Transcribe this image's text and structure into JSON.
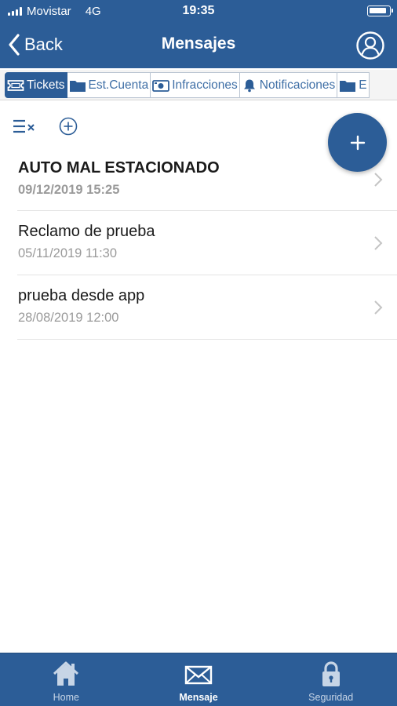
{
  "status_bar": {
    "carrier": "Movistar",
    "network": "4G",
    "time": "19:35"
  },
  "nav": {
    "back_label": "Back",
    "title": "Mensajes",
    "profile_icon": "user-circle-icon"
  },
  "tabs": [
    {
      "label": "Tickets",
      "icon": "ticket-icon",
      "active": true
    },
    {
      "label": "Est.Cuenta",
      "icon": "folder-icon",
      "active": false
    },
    {
      "label": "Infracciones",
      "icon": "camera-icon",
      "active": false
    },
    {
      "label": "Notificaciones",
      "icon": "bell-icon",
      "active": false
    },
    {
      "label": "E",
      "icon": "folder-icon",
      "active": false
    }
  ],
  "toolbar": {
    "clear_icon": "clear-list-icon",
    "add_icon": "add-circle-icon"
  },
  "fab": {
    "label": "+"
  },
  "messages": [
    {
      "subject": "AUTO MAL ESTACIONADO",
      "date": "09/12/2019 15:25",
      "unread": true
    },
    {
      "subject": "Reclamo de prueba",
      "date": "05/11/2019 11:30",
      "unread": false
    },
    {
      "subject": "prueba desde app",
      "date": "28/08/2019 12:00",
      "unread": false
    }
  ],
  "bottom_nav": [
    {
      "label": "Home",
      "icon": "home-icon",
      "active": false
    },
    {
      "label": "Mensaje",
      "icon": "envelope-icon",
      "active": true
    },
    {
      "label": "Seguridad",
      "icon": "lock-icon",
      "active": false
    }
  ],
  "colors": {
    "primary": "#2c5d97",
    "tab_text": "#3f6fa6",
    "muted_text": "#9a9a9a"
  }
}
